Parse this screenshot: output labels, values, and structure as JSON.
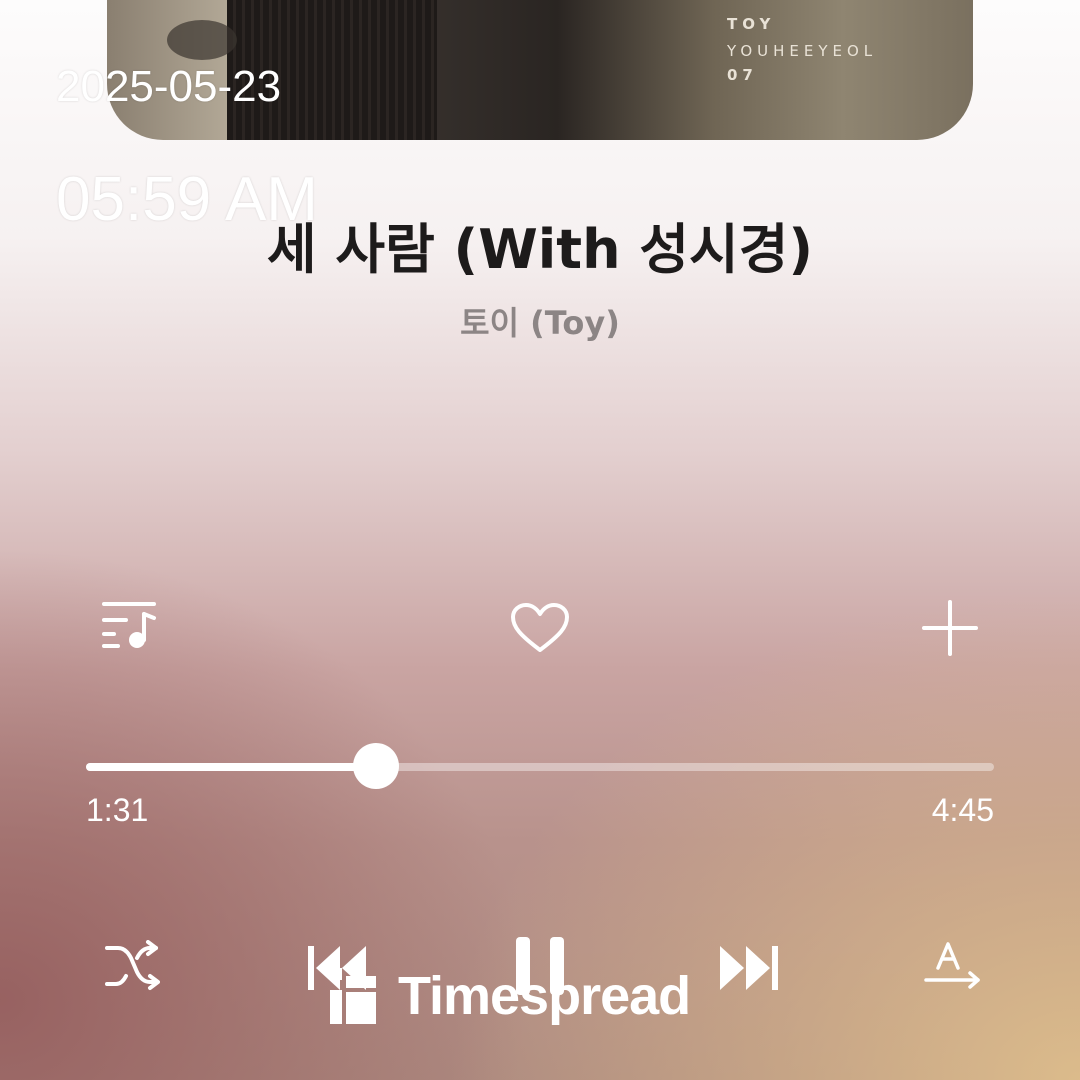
{
  "album_art": {
    "artist_text": "TOY",
    "name_text": "YOUHEEYEOL",
    "number_text": "07"
  },
  "timestamp": {
    "date": "2025-05-23",
    "time": "05:59 AM"
  },
  "track": {
    "title": "세 사람 (With 성시경)",
    "artist": "토이 (Toy)"
  },
  "actions": {
    "playlist_icon": "queue-music-icon",
    "like_icon": "heart-outline-icon",
    "add_icon": "plus-icon"
  },
  "progress": {
    "elapsed": "1:31",
    "total": "4:45",
    "fraction": 0.319
  },
  "controls": {
    "shuffle_icon": "shuffle-icon",
    "previous_icon": "skip-previous-icon",
    "pause_icon": "pause-icon",
    "next_icon": "skip-next-icon",
    "lyrics_icon": "translate-lyrics-icon"
  },
  "watermark": {
    "text": "Timespread"
  },
  "colors": {
    "title": "#1d1b1b",
    "artist": "#8c8585",
    "controls": "#ffffff"
  }
}
